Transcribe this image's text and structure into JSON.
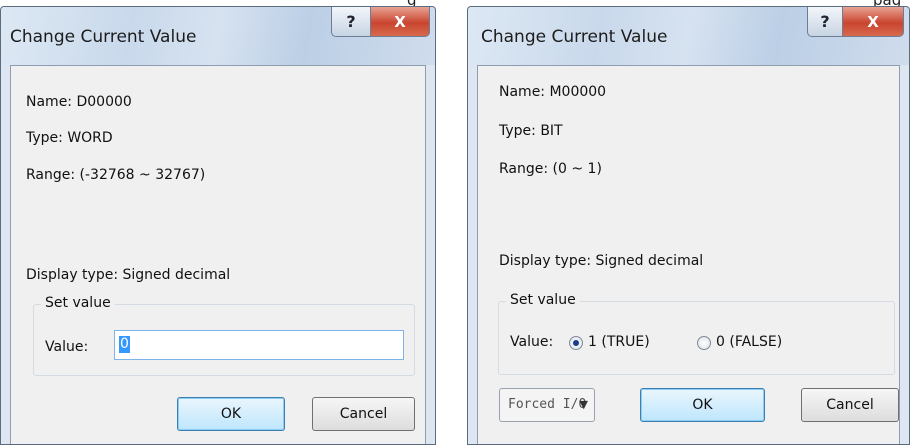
{
  "page_top_text": [
    "g",
    "pag"
  ],
  "dialogs": [
    {
      "title": "Change Current Value",
      "help_symbol": "?",
      "close_symbol": "X",
      "name": "Name:  D00000",
      "type": "Type:   WORD",
      "range": "Range: (-32768 ~ 32767)",
      "display_type": "Display type:  Signed decimal",
      "group_label": "Set value",
      "value_label": "Value:",
      "value": "0",
      "ok_label": "OK",
      "cancel_label": "Cancel"
    },
    {
      "title": "Change Current Value",
      "help_symbol": "?",
      "close_symbol": "X",
      "name": "Name:  M00000",
      "type": "Type:   BIT",
      "range": "Range: (0 ~ 1)",
      "display_type": "Display type:  Signed decimal",
      "group_label": "Set value",
      "value_label": "Value:",
      "radio_true": "1 (TRUE)",
      "radio_false": "0 (FALSE)",
      "selected": "1 (TRUE)",
      "forced_label": "Forced I/O",
      "forced_arrow": "▼",
      "ok_label": "OK",
      "cancel_label": "Cancel"
    }
  ]
}
